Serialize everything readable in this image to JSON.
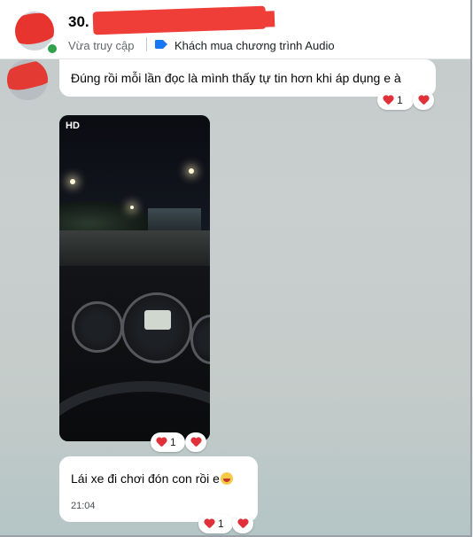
{
  "header": {
    "name": "30.",
    "presence": "Vừa truy cập",
    "tag": "Khách mua chương trình Audio",
    "tag_color": "#1877f2",
    "online_color": "#31a24c"
  },
  "messages": [
    {
      "type": "text",
      "text": "Đúng rồi mỗi lần đọc là mình thấy tự tin hơn khi áp dụng e à",
      "reaction_count": "1"
    },
    {
      "type": "video",
      "badge": "HD",
      "reaction_count": "1"
    },
    {
      "type": "text",
      "text": "Lái xe đi chơi đón con rồi e",
      "time": "21:04",
      "reaction_count": "1"
    }
  ],
  "icons": {
    "reaction": "heart-icon",
    "react_button": "heart-icon",
    "emoji": "grinning-face-icon",
    "tag": "label-tag-icon"
  },
  "colors": {
    "heart": "#e0313b",
    "accent": "#1877f2"
  }
}
